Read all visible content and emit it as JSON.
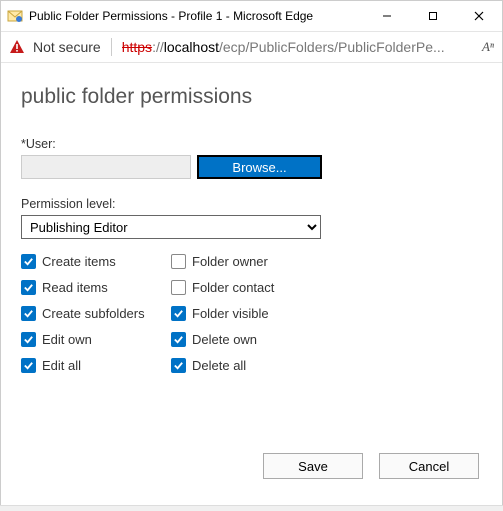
{
  "window": {
    "title": "Public Folder Permissions - Profile 1 - Microsoft Edge"
  },
  "address": {
    "not_secure": "Not secure",
    "scheme": "https",
    "sep": "://",
    "host": "localhost",
    "path": "/ecp/PublicFolders/PublicFolderPe...",
    "aa": "Aⁿ"
  },
  "page": {
    "title": "public folder permissions",
    "user_label": "*User:",
    "user_value": "",
    "browse": "Browse...",
    "perm_label": "Permission level:",
    "perm_value": "Publishing Editor"
  },
  "permissions": {
    "left": [
      {
        "label": "Create items",
        "checked": true
      },
      {
        "label": "Read items",
        "checked": true
      },
      {
        "label": "Create subfolders",
        "checked": true
      },
      {
        "label": "Edit own",
        "checked": true
      },
      {
        "label": "Edit all",
        "checked": true
      }
    ],
    "right": [
      {
        "label": "Folder owner",
        "checked": false
      },
      {
        "label": "Folder contact",
        "checked": false
      },
      {
        "label": "Folder visible",
        "checked": true
      },
      {
        "label": "Delete own",
        "checked": true
      },
      {
        "label": "Delete all",
        "checked": true
      }
    ]
  },
  "footer": {
    "save": "Save",
    "cancel": "Cancel"
  }
}
